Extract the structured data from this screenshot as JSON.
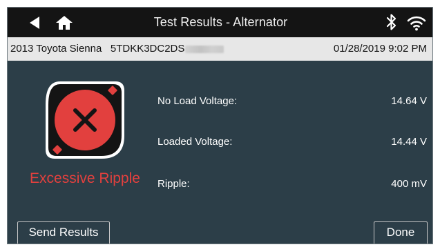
{
  "header": {
    "title": "Test Results - Alternator",
    "back_icon": "back-arrow-icon",
    "home_icon": "home-icon",
    "bluetooth_icon": "bluetooth-icon",
    "wifi_icon": "wifi-icon"
  },
  "vehicle_bar": {
    "vehicle": "2013 Toyota Sienna",
    "vin": "5TDKK3DC2DS",
    "datetime": "01/28/2019 9:02 PM"
  },
  "result": {
    "status": "Excessive Ripple",
    "icon": "fail-x-icon",
    "status_color": "#e2403e"
  },
  "measurements": [
    {
      "label": "No Load Voltage:",
      "value": "14.64 V"
    },
    {
      "label": "Loaded Voltage:",
      "value": "14.44 V"
    },
    {
      "label": "Ripple:",
      "value": "400 mV"
    }
  ],
  "buttons": {
    "send_results": "Send Results",
    "done": "Done"
  },
  "colors": {
    "background": "#2c3e48",
    "titlebar": "#141414",
    "infobar": "#e7e7e7",
    "accent_red": "#e2403e"
  }
}
